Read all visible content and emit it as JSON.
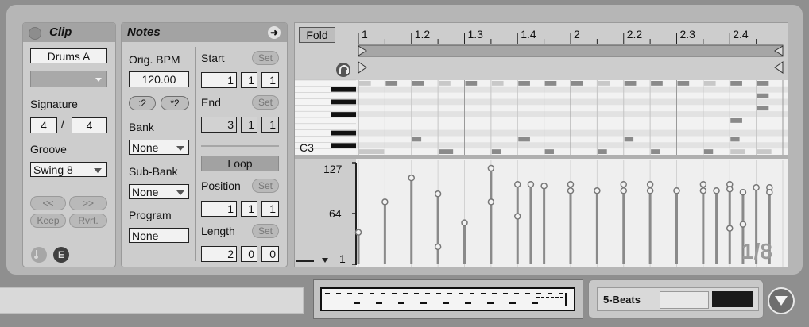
{
  "clip": {
    "title": "Clip",
    "name": "Drums A",
    "signature_label": "Signature",
    "sig_num": "4",
    "sig_sep": "/",
    "sig_den": "4",
    "groove_label": "Groove",
    "groove_value": "Swing 8",
    "nudge_back": "<<",
    "nudge_fwd": ">>",
    "keep": "Keep",
    "rvrt": "Rvrt."
  },
  "notes": {
    "title": "Notes",
    "orig_bpm_label": "Orig. BPM",
    "bpm": "120.00",
    "half": ":2",
    "double": "*2",
    "bank_label": "Bank",
    "bank_value": "None",
    "subbank_label": "Sub-Bank",
    "subbank_value": "None",
    "program_label": "Program",
    "program_value": "None",
    "start_label": "Start",
    "set": "Set",
    "start": [
      "1",
      "1",
      "1"
    ],
    "end_label": "End",
    "end": [
      "3",
      "1",
      "1"
    ],
    "loop": "Loop",
    "position_label": "Position",
    "position": [
      "1",
      "1",
      "1"
    ],
    "length_label": "Length",
    "length": [
      "2",
      "0",
      "0"
    ]
  },
  "editor": {
    "fold": "Fold",
    "ruler": [
      "1",
      "1.2",
      "1.3",
      "1.4",
      "2",
      "2.2",
      "2.3",
      "2.4"
    ],
    "key_label": "C3",
    "vel_max": "127",
    "vel_mid": "64",
    "vel_min": "1",
    "grid": "1/8"
  },
  "bottom": {
    "groove_name": "5-Beats"
  },
  "colors": {
    "panel": "#cdcdcd",
    "header": "#a3a3a3",
    "note_dark": "#8a8a8a",
    "note_light": "#c8c8c8",
    "velocity_stem": "#8a8a8a"
  },
  "icons": [
    "clip-activator-icon",
    "arrow-right-icon",
    "headphone-icon",
    "dropdown-arrow-icon",
    "chevron-down-icon",
    "midi-note-icon",
    "envelope-icon"
  ]
}
